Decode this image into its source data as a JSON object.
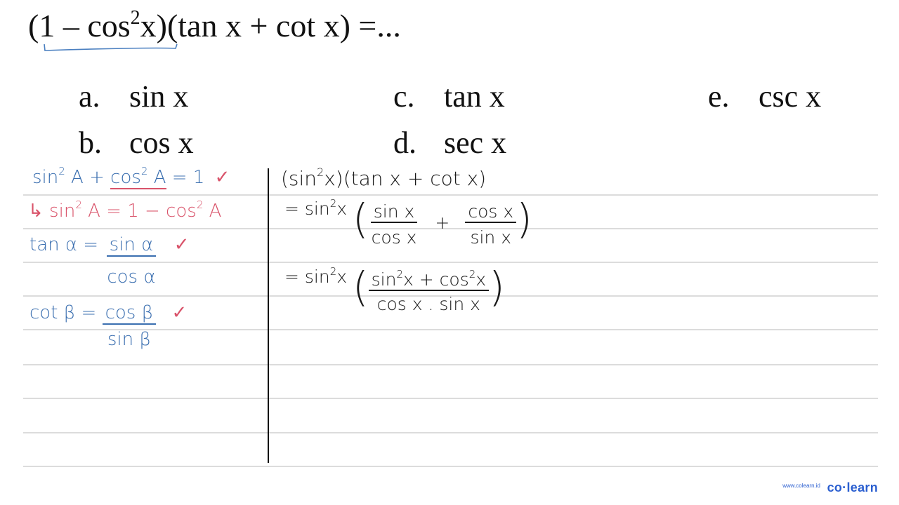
{
  "question": {
    "prefix": "(1 – cos",
    "exp": "2",
    "suffix": "x)(tan x + cot x) =..."
  },
  "options": [
    {
      "label": "a.",
      "value": "sin x"
    },
    {
      "label": "b.",
      "value": "cos x"
    },
    {
      "label": "c.",
      "value": "tan x"
    },
    {
      "label": "d.",
      "value": "sec x"
    },
    {
      "label": "e.",
      "value": "csc x"
    }
  ],
  "notes_left": {
    "identity": {
      "a": "sin",
      "a_exp": "2",
      "a2": " A + ",
      "b": "cos",
      "b_exp": "2",
      "b2": " A = 1",
      "check": "✓"
    },
    "derived": {
      "arrow": "↳",
      "a": " sin",
      "a_exp": "2",
      "a2": " A = 1 − cos",
      "b_exp": "2",
      "b2": " A"
    },
    "tan_def": {
      "lhs": "tan α = ",
      "num": "sin α",
      "den": "cos α",
      "check": "✓"
    },
    "cot_def": {
      "lhs": "cot β = ",
      "num": "cos β",
      "den": "sin β",
      "check": "✓"
    }
  },
  "notes_right": {
    "step1": {
      "a": "(sin",
      "exp": "2",
      "b": "x)(tan x + cot x)"
    },
    "step2": {
      "eq": "= sin",
      "exp": "2",
      "x": "x",
      "f1_num": "sin x",
      "f1_den": "cos x",
      "plus": "+",
      "f2_num": "cos x",
      "f2_den": "sin x"
    },
    "step3": {
      "eq": "= sin",
      "exp": "2",
      "x": "x",
      "num_a": "sin",
      "num_exp1": "2",
      "num_b": "x + cos",
      "num_exp2": "2",
      "num_c": "x",
      "den": "cos x . sin x"
    }
  },
  "footer": {
    "url": "www.colearn.id",
    "brand": "co·learn"
  },
  "colors": {
    "ink_blue": "#3b6fb0",
    "ink_red": "#d9536a",
    "brand_blue": "#2b5fd0"
  }
}
